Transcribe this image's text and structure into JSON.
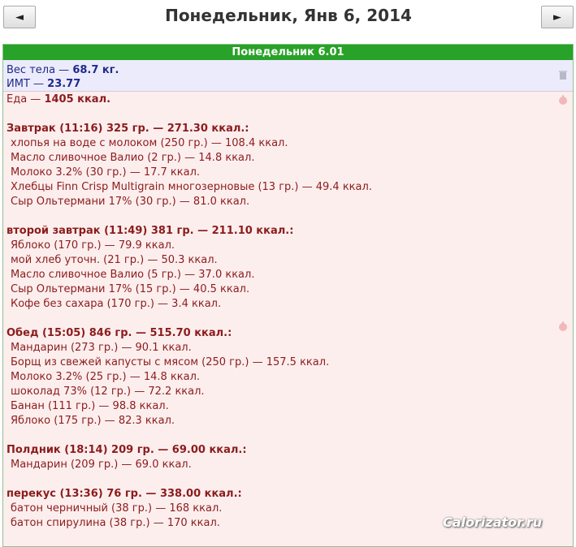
{
  "header": {
    "prev_label": "◄",
    "next_label": "►",
    "date_title": "Понедельник, Янв 6, 2014"
  },
  "panel": {
    "title": "Понедельник 6.01"
  },
  "body_stats": {
    "weight_label": "Вес тела — ",
    "weight_value": "68.7 кг.",
    "bmi_label": "ИМТ — ",
    "bmi_value": "23.77"
  },
  "food": {
    "total_label": "Еда — ",
    "total_value": "1405 ккал."
  },
  "meals": [
    {
      "title": "Завтрак (11:16) 325 гр. — 271.30 ккал.:",
      "items": [
        "хлопья на воде с молоком (250 гр.) — 108.4 ккал.",
        "Масло сливочное Валио (2 гр.) — 14.8 ккал.",
        "Молоко 3.2% (30 гр.) — 17.7 ккал.",
        "Хлебцы Finn Crisp Multigrain многозерновые (13 гр.) — 49.4 ккал.",
        "Сыр Ольтермани 17% (30 гр.) — 81.0 ккал."
      ]
    },
    {
      "title": "второй завтрак (11:49) 381 гр. — 211.10 ккал.:",
      "items": [
        "Яблоко (170 гр.) — 79.9 ккал.",
        "мой хлеб уточн. (21 гр.) — 50.3 ккал.",
        "Масло сливочное Валио (5 гр.) — 37.0 ккал.",
        "Сыр Ольтермани 17% (15 гр.) — 40.5 ккал.",
        "Кофе без сахара (170 гр.) — 3.4 ккал."
      ]
    },
    {
      "title": "Обед (15:05) 846 гр. — 515.70 ккал.:",
      "items": [
        "Мандарин (273 гр.) — 90.1 ккал.",
        "Борщ из свежей капусты с мясом (250 гр.) — 157.5 ккал.",
        "Молоко 3.2% (25 гр.) — 14.8 ккал.",
        "шоколад 73% (12 гр.) — 72.2 ккал.",
        "Банан (111 гр.) — 98.8 ккал.",
        "Яблоко (175 гр.) — 82.3 ккал."
      ]
    },
    {
      "title": "Полдник (18:14) 209 гр. — 69.00 ккал.:",
      "items": [
        "Мандарин (209 гр.) — 69.0 ккал."
      ]
    },
    {
      "title": "перекус (13:36) 76 гр. — 338.00 ккал.:",
      "items": [
        "батон черничный (38 гр.) — 168 ккал.",
        "батон спирулина (38 гр.) — 170 ккал."
      ]
    }
  ],
  "watermark": "Calorizator.ru",
  "icons": {
    "weight_icon": "trash-icon",
    "food_icon": "apple-icon",
    "lunch_icon": "apple-icon"
  }
}
